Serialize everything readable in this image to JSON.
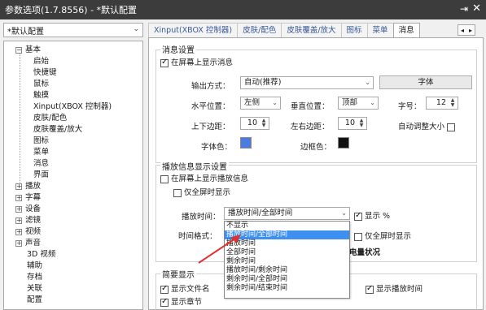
{
  "window": {
    "title": "参数选项(1.7.8556) - *默认配置"
  },
  "profile": {
    "value": "*默认配置"
  },
  "tree": {
    "items": [
      {
        "label": "基本",
        "expander": "−",
        "level": 0
      },
      {
        "label": "启始",
        "level": 1
      },
      {
        "label": "快捷键",
        "level": 1
      },
      {
        "label": "鼠标",
        "level": 1
      },
      {
        "label": "触摸",
        "level": 1
      },
      {
        "label": "Xinput(XBOX 控制器)",
        "level": 1
      },
      {
        "label": "皮肤/配色",
        "level": 1
      },
      {
        "label": "皮肤覆盖/放大",
        "level": 1
      },
      {
        "label": "图标",
        "level": 1
      },
      {
        "label": "菜单",
        "level": 1
      },
      {
        "label": "消息",
        "level": 1
      },
      {
        "label": "界面",
        "level": 1
      },
      {
        "label": "播放",
        "expander": "+",
        "level": 0
      },
      {
        "label": "字幕",
        "expander": "+",
        "level": 0
      },
      {
        "label": "设备",
        "expander": "+",
        "level": 0
      },
      {
        "label": "滤镜",
        "expander": "+",
        "level": 0
      },
      {
        "label": "视频",
        "expander": "+",
        "level": 0
      },
      {
        "label": "声音",
        "expander": "+",
        "level": 0
      },
      {
        "label": "3D 视频",
        "level": 0
      },
      {
        "label": "辅助",
        "level": 0
      },
      {
        "label": "存档",
        "level": 0
      },
      {
        "label": "关联",
        "level": 0
      },
      {
        "label": "配置",
        "level": 0
      }
    ]
  },
  "tabs": [
    "Xinput(XBOX 控制器)",
    "皮肤/配色",
    "皮肤覆盖/放大",
    "图标",
    "菜单",
    "消息"
  ],
  "active_tab": "消息",
  "msg_settings": {
    "title": "消息设置",
    "show_on_screen": "在屏幕上显示消息",
    "output_label": "输出方式：",
    "output_value": "自动(推荐)",
    "font_button": "字体",
    "hpos_label": "水平位置：",
    "hpos_value": "左侧",
    "vpos_label": "垂直位置：",
    "vpos_value": "顶部",
    "size_label": "字号：",
    "size_value": "12",
    "vmargin_label": "上下边距：",
    "vmargin_value": "10",
    "hmargin_label": "左右边距：",
    "hmargin_value": "10",
    "autosize_label": "自动调整大小",
    "fontcolor_label": "字体色：",
    "bordercolor_label": "边框色："
  },
  "play_info": {
    "title": "播放信息显示设置",
    "show_on_screen": "在屏幕上显示播放信息",
    "fullscreen_only": "仅全屏时显示",
    "time_label": "播放时间：",
    "time_value": "播放时间/全部时间",
    "show_percent": "显示 %",
    "format_label": "时间格式：",
    "fullscreen_only2": "仅全屏时显示",
    "battery_label": "电量状况"
  },
  "dropdown": {
    "options": [
      "不显示",
      "播放时间/全部时间",
      "播放时间",
      "全部时间",
      "剩余时间",
      "播放时间/剩余时间",
      "剩余时间/全部时间",
      "剩余时间/结束时间"
    ],
    "selected_index": 1
  },
  "brief": {
    "title": "简要显示",
    "show_filename": "显示文件名",
    "show_play_time": "显示播放时间",
    "show_chapter": "显示章节"
  },
  "colors": {
    "accent": "#3d8ff0",
    "font_color": "#4a7be0",
    "border_color": "#111111",
    "arrow": "#e03030"
  }
}
